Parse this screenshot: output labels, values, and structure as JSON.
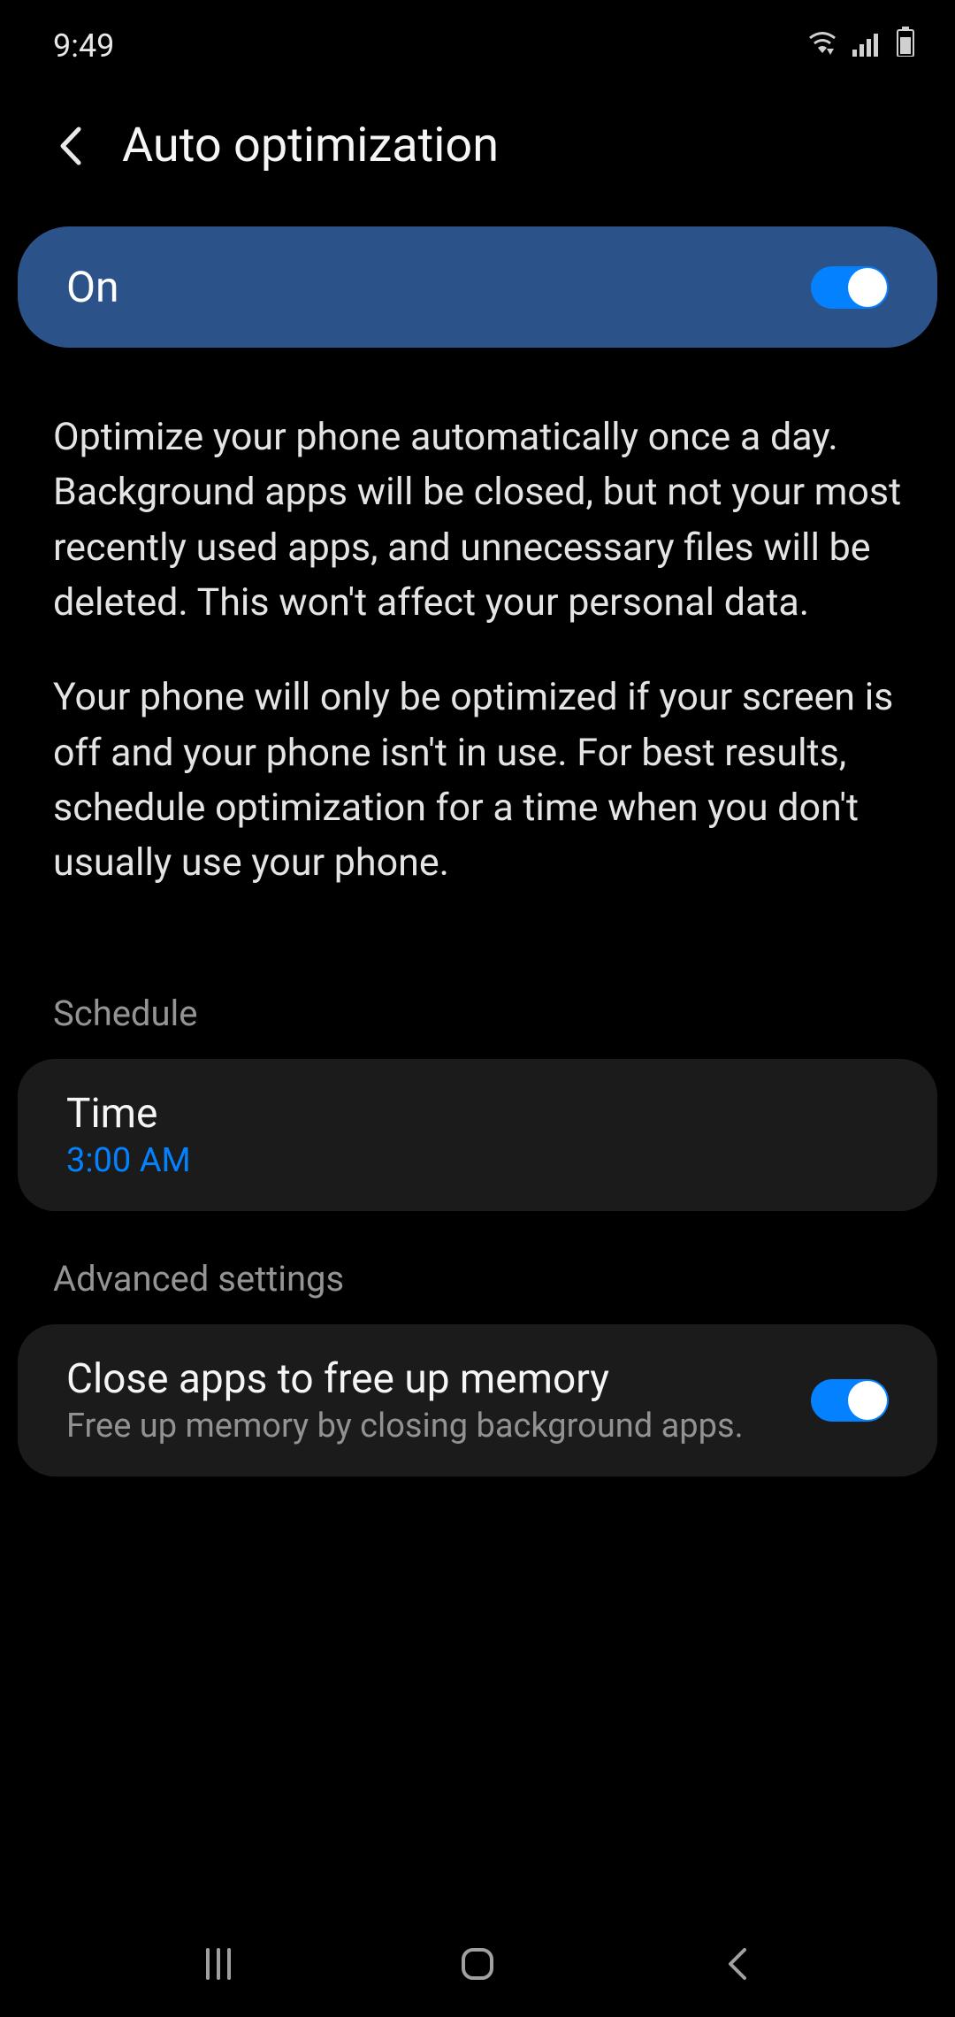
{
  "statusBar": {
    "time": "9:49"
  },
  "header": {
    "title": "Auto optimization"
  },
  "mainToggle": {
    "label": "On",
    "enabled": true
  },
  "description": {
    "p1": "Optimize your phone automatically once a day. Background apps will be closed, but not your most recently used apps, and unnecessary files will be deleted. This won't affect your personal data.",
    "p2": "Your phone will only be optimized if your screen is off and your phone isn't in use. For best results, schedule optimization for a time when you don't usually use your phone."
  },
  "schedule": {
    "header": "Schedule",
    "time": {
      "label": "Time",
      "value": "3:00 AM"
    }
  },
  "advanced": {
    "header": "Advanced settings",
    "closeApps": {
      "title": "Close apps to free up memory",
      "subtitle": "Free up memory by closing background apps.",
      "enabled": true
    }
  }
}
